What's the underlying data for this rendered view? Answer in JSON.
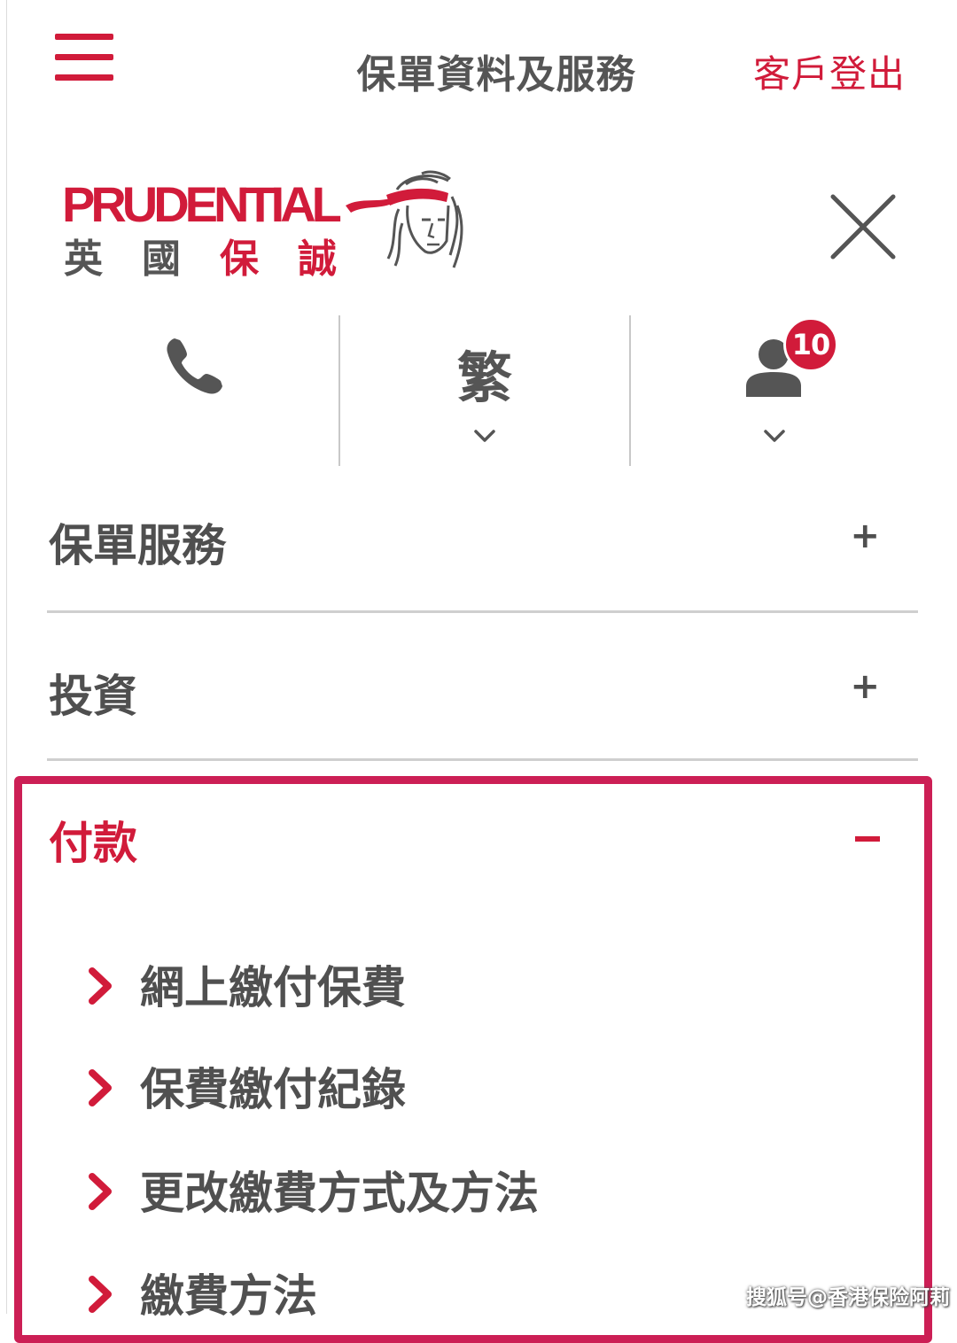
{
  "header": {
    "title": "保單資料及服務",
    "logout_label": "客戶登出",
    "menu_icon": "hamburger-menu-icon"
  },
  "logo": {
    "brand_en": "PRUDENTIAL",
    "brand_zh": [
      "英",
      "國",
      "保",
      "誠"
    ],
    "brand_color": "#d11b3a"
  },
  "close_icon": "close-icon",
  "icon_row": {
    "phone_icon": "phone-icon",
    "language_label": "繁",
    "user_icon": "user-icon",
    "notification_count": "10"
  },
  "menu": {
    "policy_services": {
      "label": "保單服務",
      "sign": "+"
    },
    "investment": {
      "label": "投資",
      "sign": "+"
    },
    "payment": {
      "label": "付款",
      "expanded": true,
      "items": [
        {
          "label": "網上繳付保費"
        },
        {
          "label": "保費繳付紀錄"
        },
        {
          "label": "更改繳費方式及方法"
        },
        {
          "label": "繳費方法"
        }
      ]
    }
  },
  "watermark": "搜狐号@香港保险阿莉",
  "colors": {
    "accent": "#d11b3a",
    "highlight": "#cc1f55",
    "text": "#4f4f4f",
    "divider": "#cfcfcf"
  }
}
